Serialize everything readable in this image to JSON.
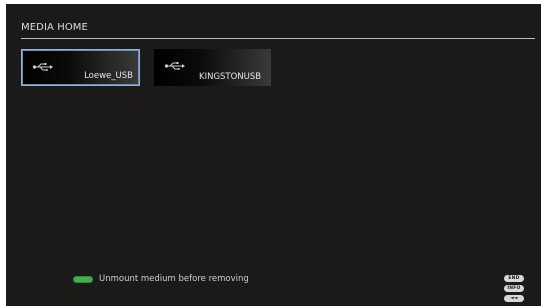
{
  "header": {
    "title": "MEDIA HOME"
  },
  "devices": [
    {
      "label": "Loewe_USB",
      "icon": "usb-icon",
      "selected": true
    },
    {
      "label": "KINGSTONUSB",
      "icon": "usb-icon",
      "selected": false
    }
  ],
  "status": {
    "indicator_color": "#3fb34a",
    "text": "Unmount medium before removing"
  },
  "remote_keys": [
    {
      "label": "END"
    },
    {
      "label": "INFO"
    },
    {
      "label": "◄◄"
    }
  ],
  "colors": {
    "background": "#1b1a19",
    "selection_border": "#8fb4dc"
  }
}
